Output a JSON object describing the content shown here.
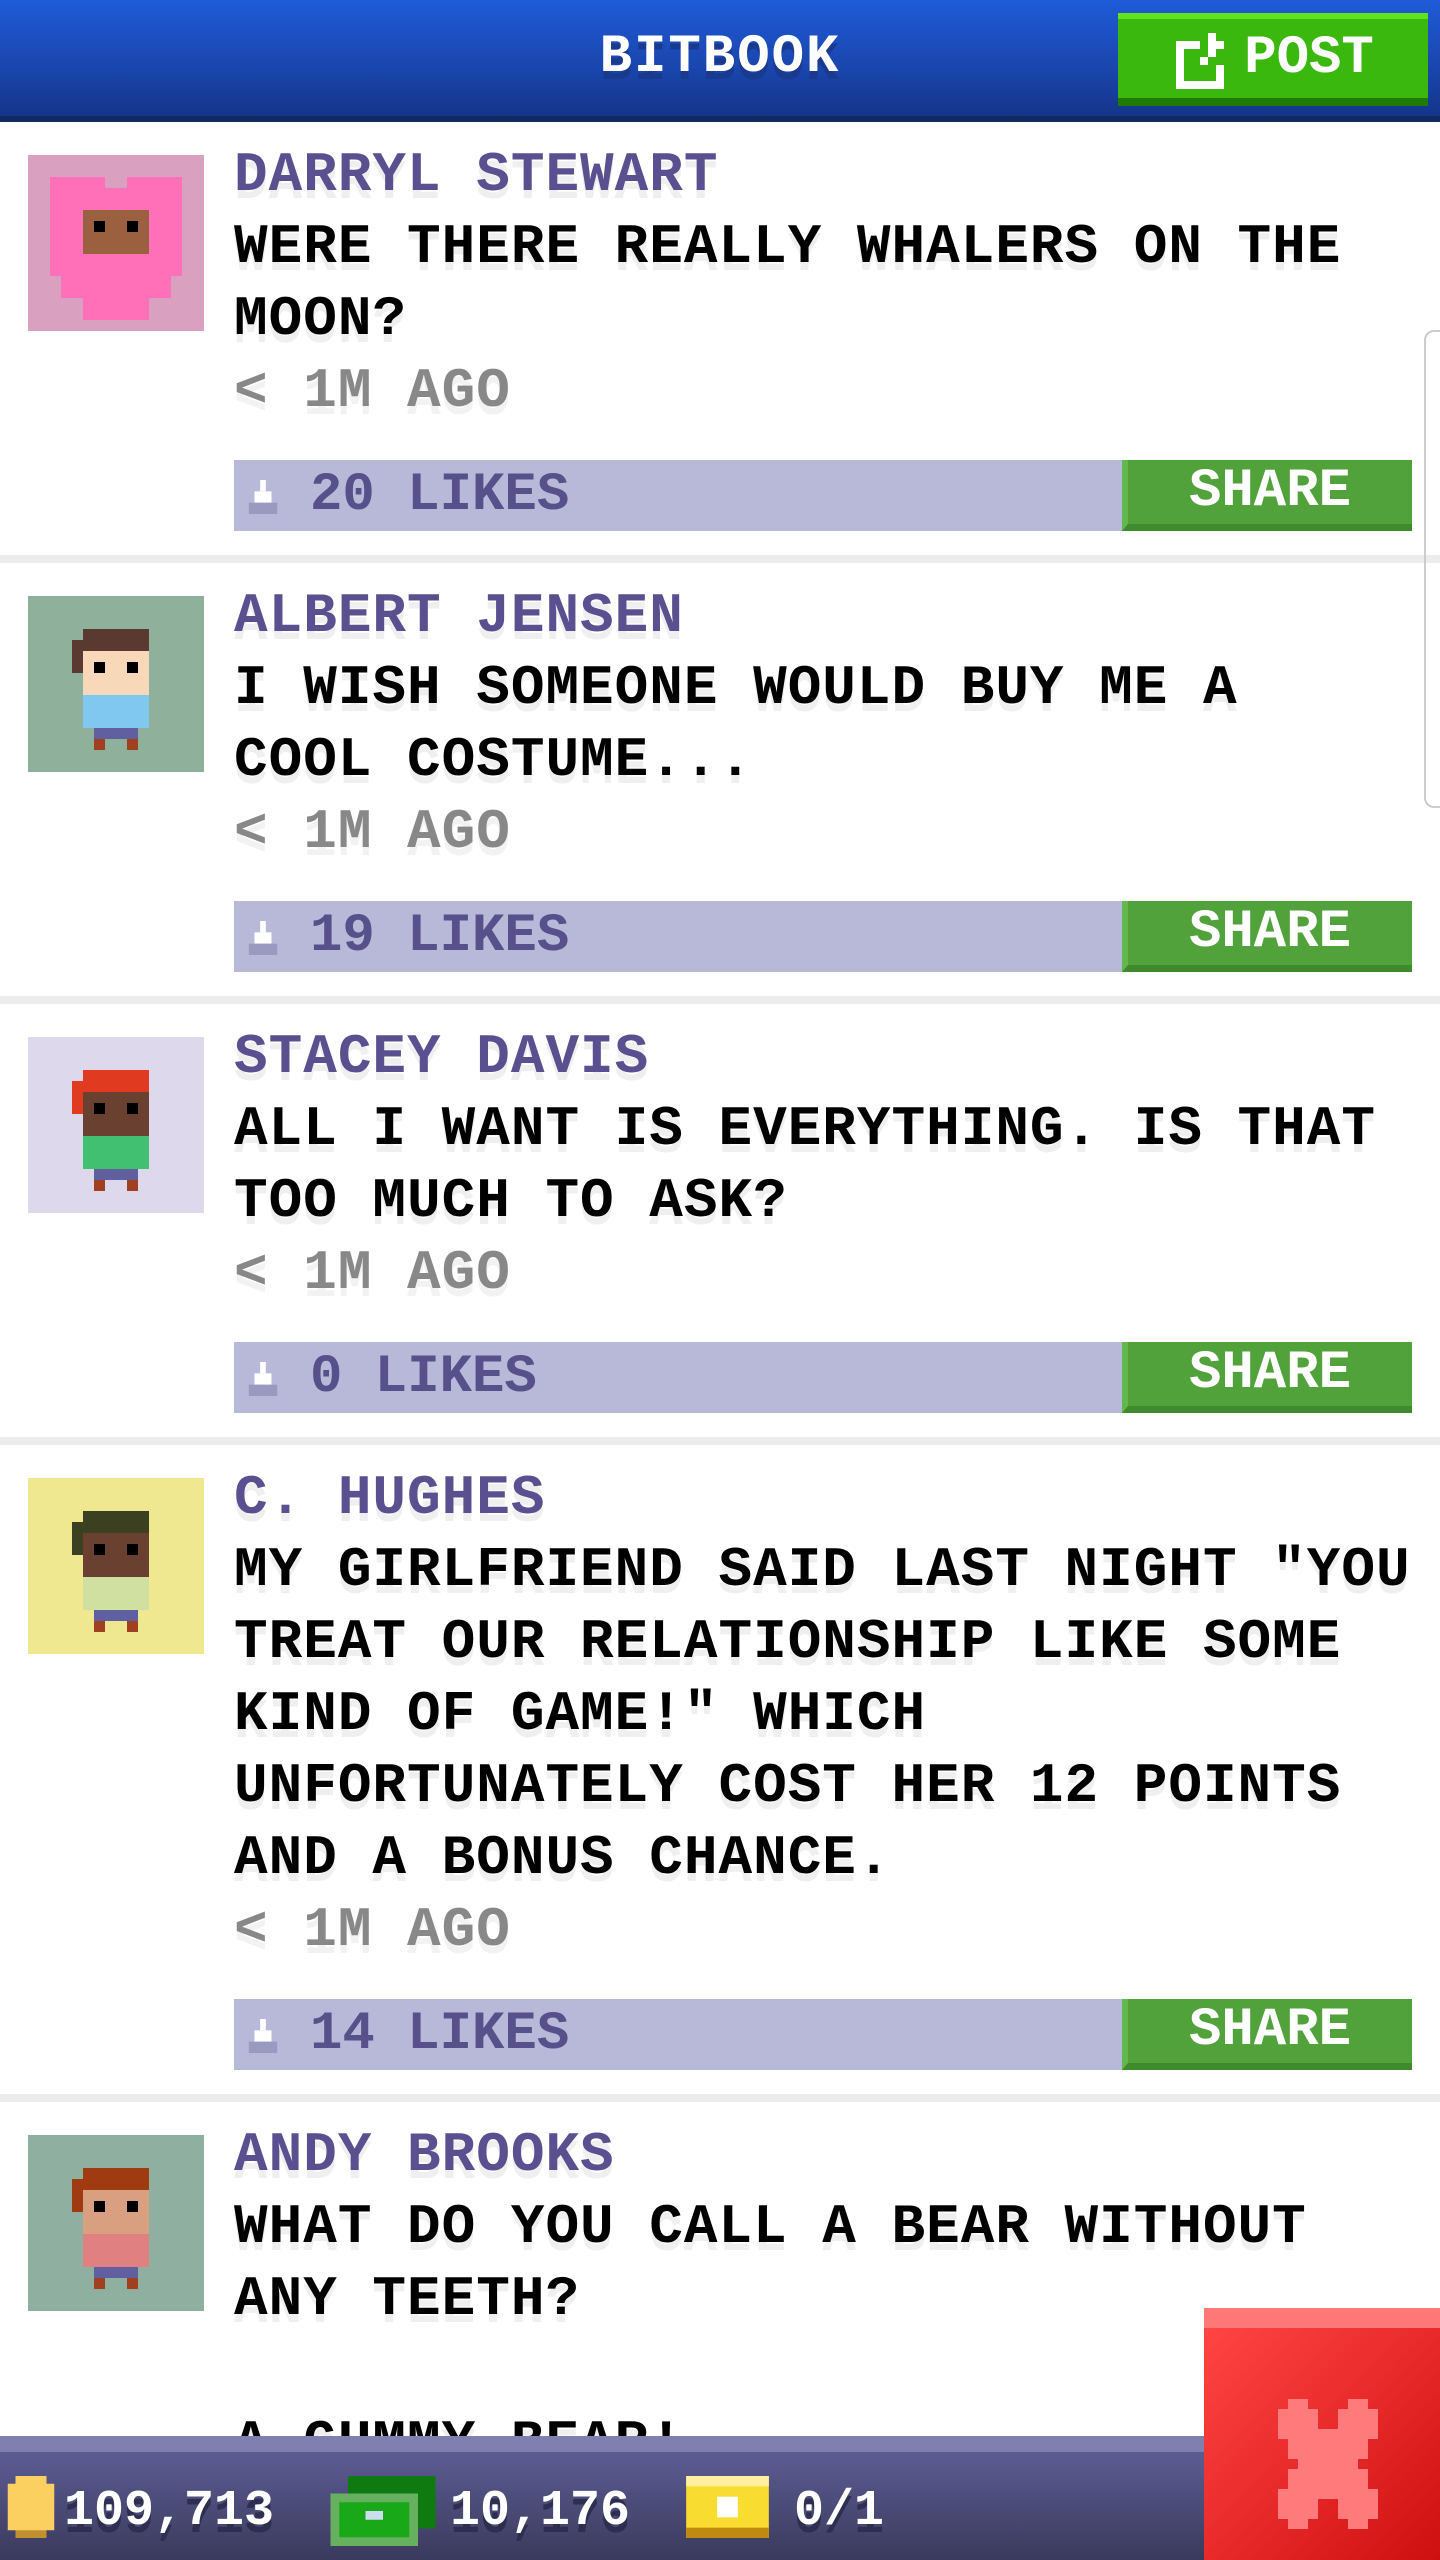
{
  "header": {
    "title": "BITBOOK",
    "post_label": "POST"
  },
  "posts": [
    {
      "name": "DARRYL STEWART",
      "lines": [
        "WERE THERE REALLY WHALERS ON THE",
        "MOON?"
      ],
      "time": "< 1M AGO",
      "likes": "20 LIKES",
      "share": "SHARE",
      "avatar_bg": "#d9a0c0",
      "avatar": "pink-heart-costume"
    },
    {
      "name": "ALBERT JENSEN",
      "lines": [
        "I WISH SOMEONE WOULD BUY ME A",
        "COOL COSTUME..."
      ],
      "time": "< 1M AGO",
      "likes": "19 LIKES",
      "share": "SHARE",
      "avatar_bg": "#8fb09a",
      "avatar": "boy-blue-shirt"
    },
    {
      "name": "STACEY DAVIS",
      "lines": [
        "ALL I WANT IS EVERYTHING. IS THAT",
        "TOO MUCH TO ASK?"
      ],
      "time": "< 1M AGO",
      "likes": "0 LIKES",
      "share": "SHARE",
      "avatar_bg": "#ddd8ec",
      "avatar": "girl-red-hair"
    },
    {
      "name": "C. HUGHES",
      "lines": [
        "MY GIRLFRIEND SAID LAST NIGHT \"YOU",
        "TREAT OUR RELATIONSHIP LIKE SOME",
        "KIND OF GAME!\" WHICH",
        "UNFORTUNATELY COST HER 12 POINTS",
        "AND A BONUS CHANCE."
      ],
      "time": "< 1M AGO",
      "likes": "14 LIKES",
      "share": "SHARE",
      "avatar_bg": "#f0e890",
      "avatar": "golfer-cap"
    },
    {
      "name": "ANDY BROOKS",
      "lines": [
        "WHAT DO YOU CALL A BEAR WITHOUT",
        "ANY TEETH?",
        "",
        "A GUMMY BEAR!"
      ],
      "time": "",
      "likes": "",
      "share": "",
      "avatar_bg": "#8fb0a0",
      "avatar": "man-orange-hat"
    }
  ],
  "bottom_bar": {
    "coins": "109,713",
    "bux": "10,176",
    "tickets": "0/1"
  },
  "colors": {
    "header": "#1f5bd8",
    "post": "#3ab80e",
    "share": "#52a23c",
    "likes_bar": "#b8b8d8",
    "name": "#5a5090",
    "close": "#e02020"
  }
}
